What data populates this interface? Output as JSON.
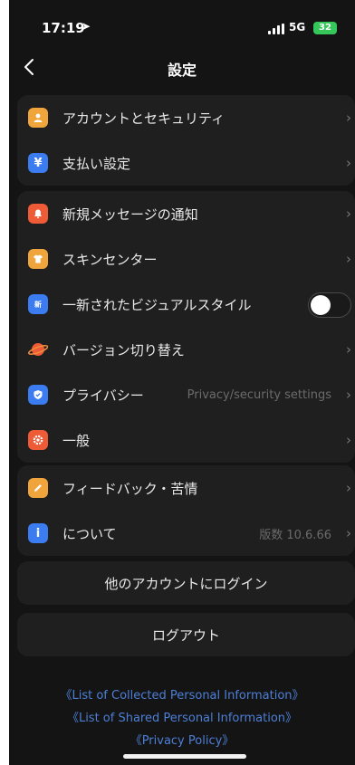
{
  "status_bar": {
    "time": "17:19",
    "network": "5G",
    "battery": "32"
  },
  "header": {
    "title": "設定"
  },
  "groups": [
    {
      "items": [
        {
          "label": "アカウントとセキュリティ",
          "icon": "person-icon",
          "color": "#f0a53c"
        },
        {
          "label": "支払い設定",
          "icon": "yen-icon",
          "color": "#3b7cf0"
        }
      ]
    },
    {
      "items": [
        {
          "label": "新規メッセージの通知",
          "icon": "bell-icon",
          "color": "#ef5a37"
        },
        {
          "label": "スキンセンター",
          "icon": "shirt-icon",
          "color": "#f0a53c"
        },
        {
          "label": "一新されたビジュアルスタイル",
          "icon": "new-style-icon",
          "color": "#3b7cf0",
          "toggle": "off"
        },
        {
          "label": "バージョン切り替え",
          "icon": "planet-icon",
          "color": "#ef5a37"
        },
        {
          "label": "プライバシー",
          "value": "Privacy/security settings",
          "icon": "shield-icon",
          "color": "#3b7cf0"
        },
        {
          "label": "一般",
          "icon": "gear-icon",
          "color": "#ef5a37"
        }
      ]
    },
    {
      "items": [
        {
          "label": "フィードバック・苦情",
          "icon": "pencil-icon",
          "color": "#f0a53c"
        },
        {
          "label": "について",
          "value": "版数 10.6.66",
          "icon": "info-icon",
          "color": "#3b7cf0"
        }
      ]
    }
  ],
  "buttons": {
    "switch_account": "他のアカウントにログイン",
    "logout": "ログアウト"
  },
  "links": [
    "《List of Collected Personal Information》",
    "《List of Shared Personal Information》",
    "《Privacy Policy》"
  ]
}
